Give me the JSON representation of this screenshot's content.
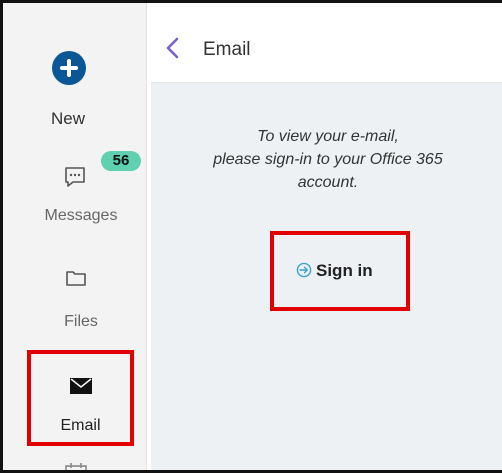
{
  "sidebar": {
    "new": {
      "label": "New",
      "icon": "plus-circle-icon",
      "color": "#0a5696"
    },
    "messages": {
      "label": "Messages",
      "icon": "chat-bubble-icon",
      "badge": "56",
      "badge_color": "#5fd1b1"
    },
    "files": {
      "label": "Files",
      "icon": "folder-icon"
    },
    "email": {
      "label": "Email",
      "icon": "envelope-icon",
      "highlight_color": "#e10000"
    },
    "next_icon": "calendar-icon"
  },
  "header": {
    "back_icon": "chevron-left-icon",
    "title": "Email"
  },
  "content": {
    "message_lines": [
      "To view your e-mail,",
      "please sign-in to your Office 365",
      "account."
    ],
    "signin_label": "Sign in",
    "signin_icon": "sign-in-icon",
    "highlight_color": "#e10000"
  }
}
